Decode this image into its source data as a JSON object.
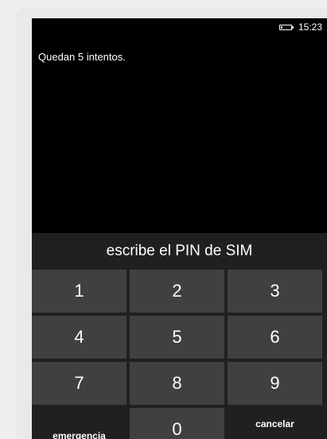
{
  "status_bar": {
    "battery_icon": "battery-low-icon",
    "time": "15:23"
  },
  "message": "Quedan 5 intentos.",
  "prompt": "escribe el PIN de SIM",
  "keypad": {
    "keys": [
      "1",
      "2",
      "3",
      "4",
      "5",
      "6",
      "7",
      "8",
      "9"
    ],
    "emergency_label": "emergencia",
    "zero": "0",
    "cancel_label": "cancelar"
  },
  "colors": {
    "screen_background": "#000000",
    "panel_background": "#202020",
    "key_background": "#404040",
    "text": "#ffffff"
  }
}
